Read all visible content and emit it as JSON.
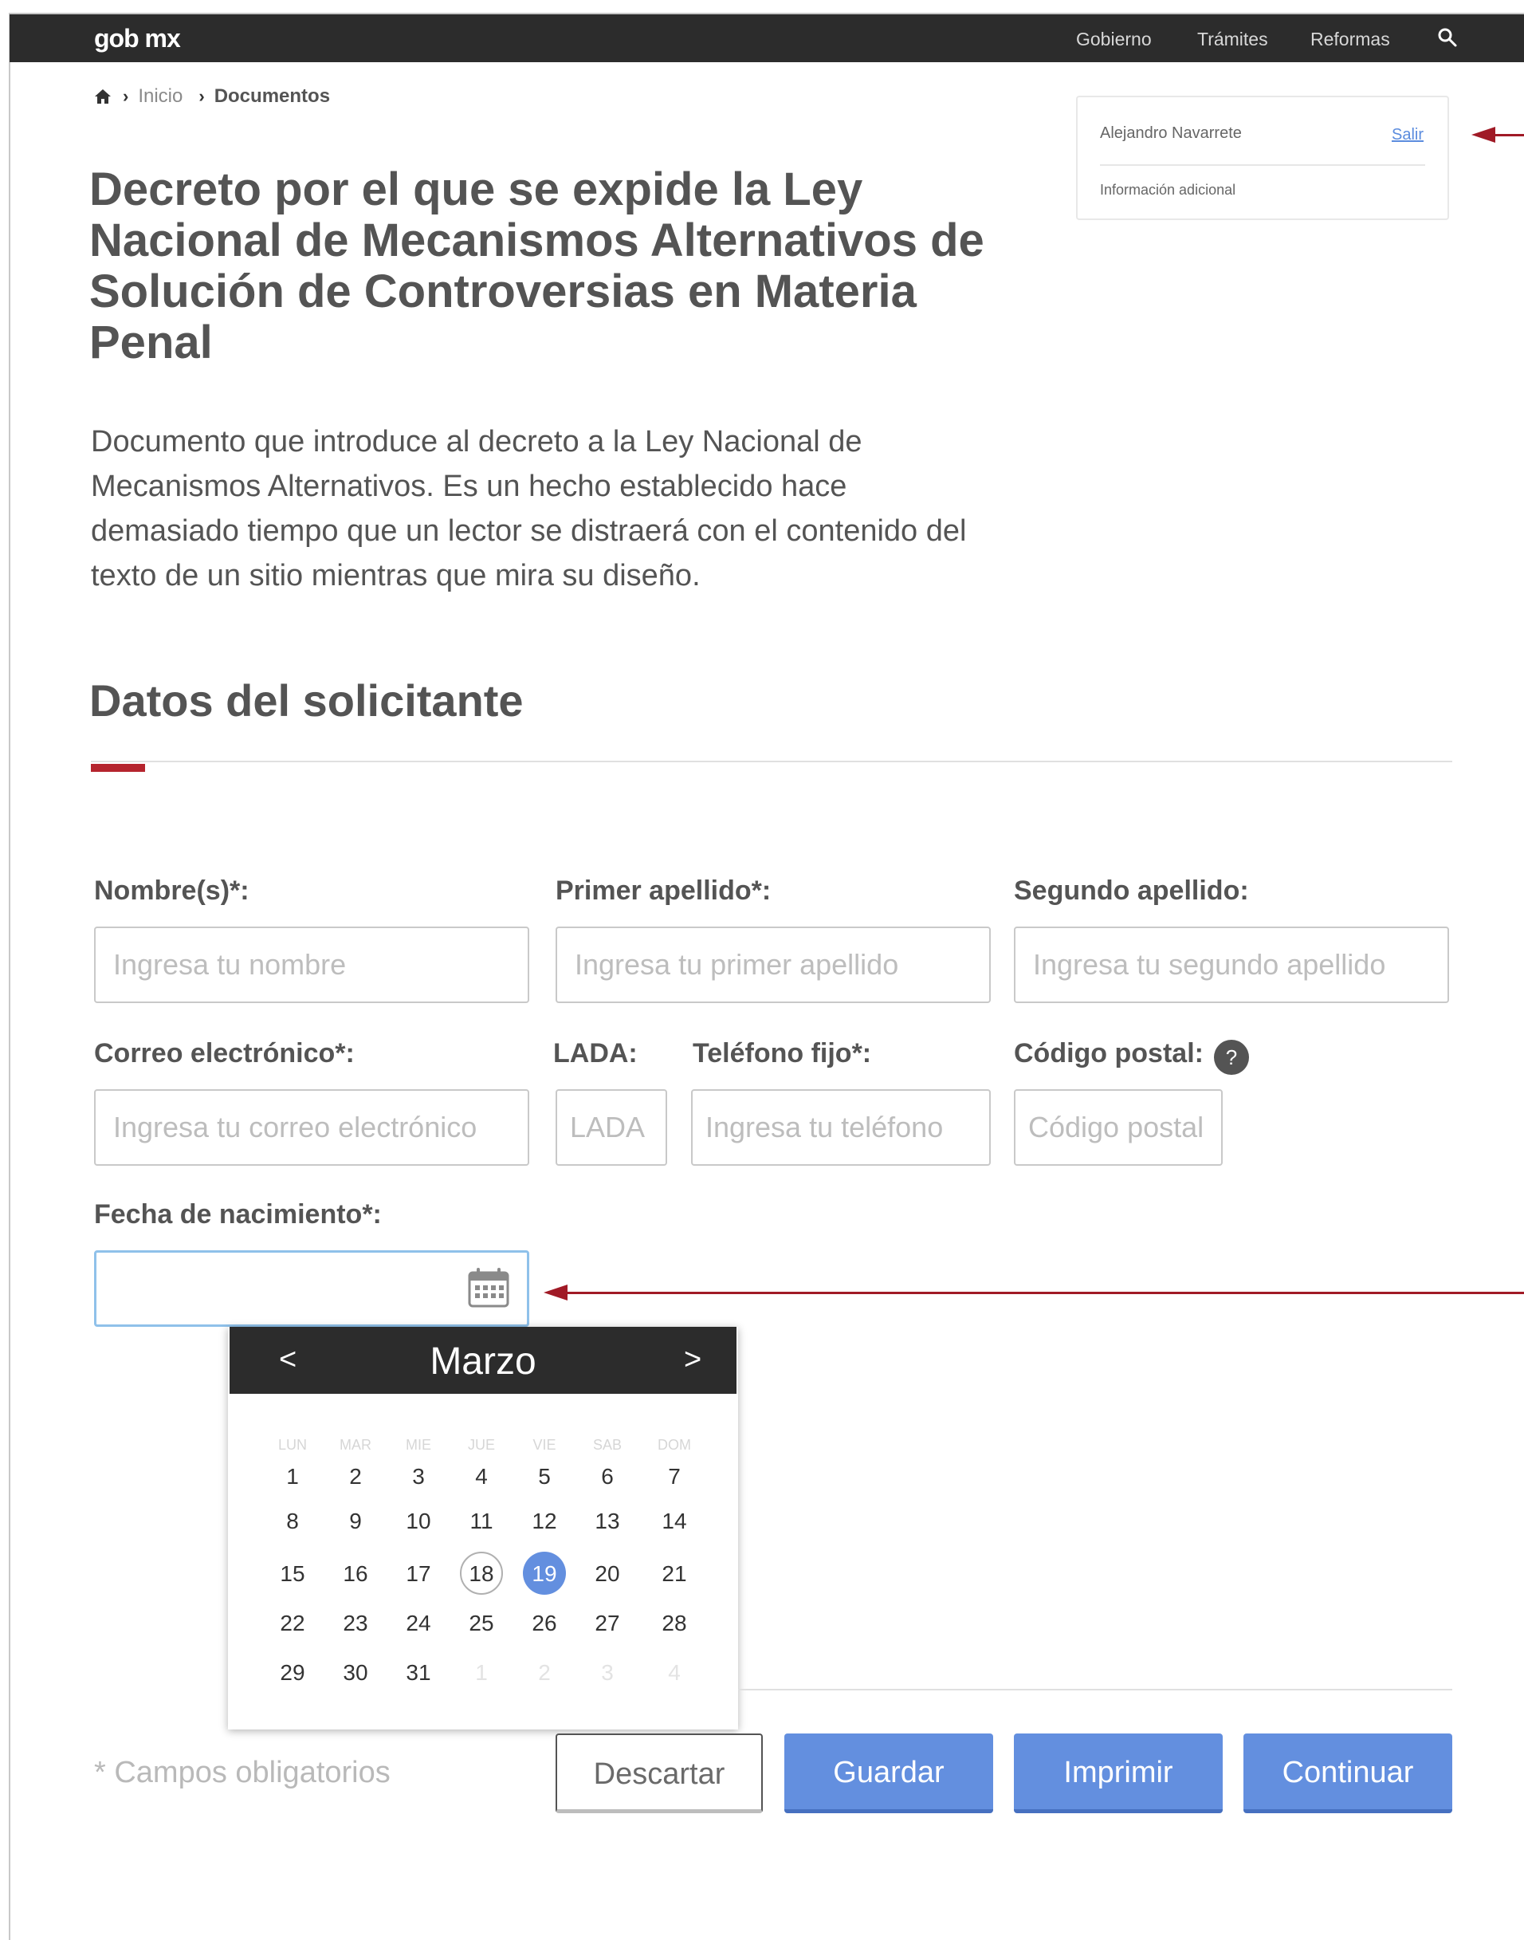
{
  "navbar": {
    "logo": "gob mx",
    "links": [
      "Gobierno",
      "Trámites",
      "Reformas"
    ]
  },
  "breadcrumb": {
    "home": "Inicio",
    "current": "Documentos"
  },
  "user_card": {
    "name": "Alejandro Navarrete",
    "logout": "Salir",
    "info": "Información adicional"
  },
  "page": {
    "title": "Decreto por el que se expide la Ley Nacional de Mecanismos Alternativos de Solución de Controversias en Materia Penal",
    "intro": "Documento que introduce al decreto a la Ley Nacional de Mecanismos Alternativos. Es un hecho establecido hace demasiado tiempo que un lector se distraerá con el contenido del texto de un sitio mientras que mira su diseño.",
    "section_title": "Datos del solicitante"
  },
  "form": {
    "nombre": {
      "label": "Nombre(s)*:",
      "placeholder": "Ingresa tu nombre"
    },
    "primer_apellido": {
      "label": "Primer apellido*:",
      "placeholder": "Ingresa tu primer apellido"
    },
    "segundo_apellido": {
      "label": "Segundo apellido:",
      "placeholder": "Ingresa tu segundo apellido"
    },
    "correo": {
      "label": "Correo electrónico*:",
      "placeholder": "Ingresa tu correo electrónico"
    },
    "lada": {
      "label": "LADA:",
      "placeholder": "LADA"
    },
    "telefono": {
      "label": "Teléfono fijo*:",
      "placeholder": "Ingresa tu teléfono"
    },
    "codigo_postal": {
      "label": "Código postal:",
      "placeholder": "Código postal",
      "help": "?"
    },
    "fecha": {
      "label": "Fecha de nacimiento*:",
      "value": ""
    }
  },
  "calendar": {
    "prev": "<",
    "next": ">",
    "month": "Marzo",
    "weekdays": [
      "LUN",
      "MAR",
      "MIE",
      "JUE",
      "VIE",
      "SAB",
      "DOM"
    ],
    "weeks": [
      [
        "1",
        "2",
        "3",
        "4",
        "5",
        "6",
        "7"
      ],
      [
        "8",
        "9",
        "10",
        "11",
        "12",
        "13",
        "14"
      ],
      [
        "15",
        "16",
        "17",
        "18",
        "19",
        "20",
        "21"
      ],
      [
        "22",
        "23",
        "24",
        "25",
        "26",
        "27",
        "28"
      ],
      [
        "29",
        "30",
        "31",
        "1",
        "2",
        "3",
        "4"
      ]
    ],
    "today": "18",
    "selected": "19"
  },
  "footer": {
    "required_note": "* Campos obligatorios",
    "buttons": {
      "discard": "Descartar",
      "save": "Guardar",
      "print": "Imprimir",
      "continue": "Continuar"
    }
  },
  "colors": {
    "navbar": "#2c2c2c",
    "accent": "#b5242e",
    "primary_button": "#638fdf",
    "selected_day": "#638fdf"
  }
}
